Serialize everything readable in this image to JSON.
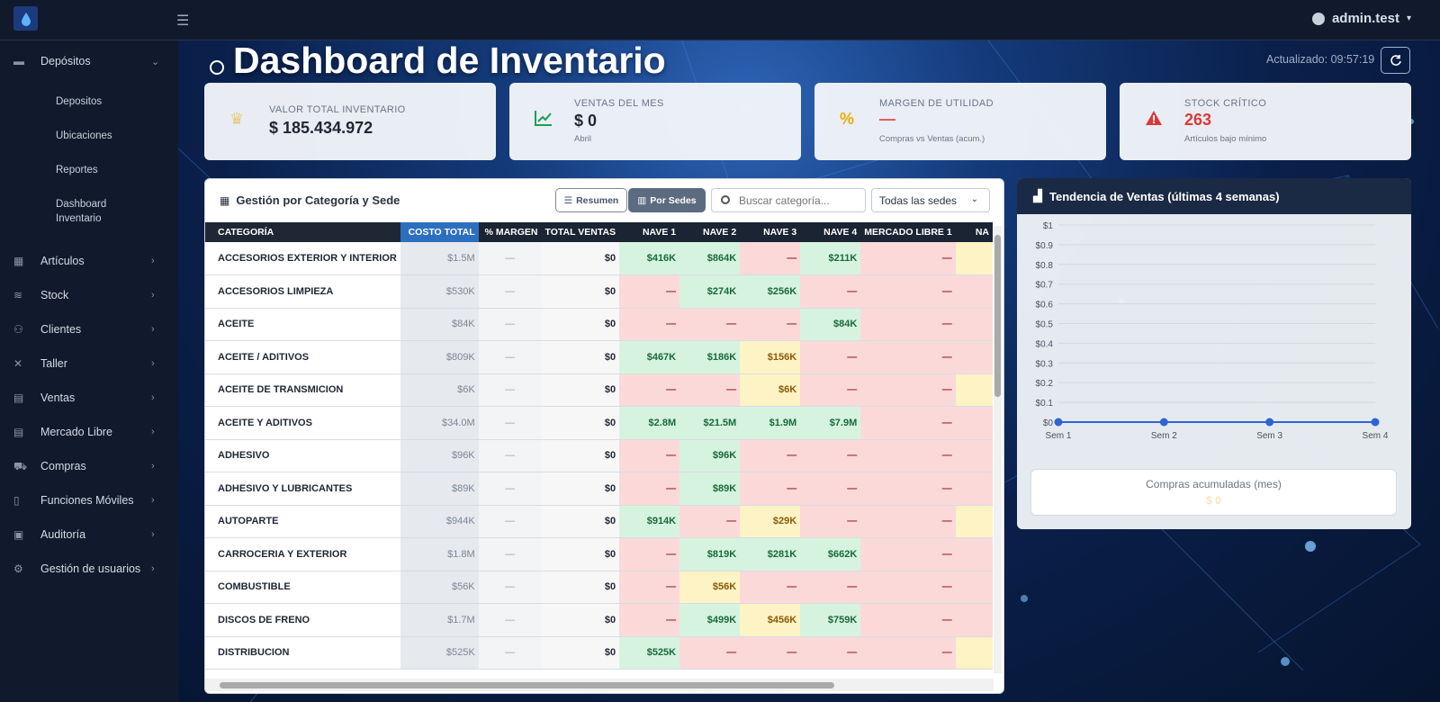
{
  "topbar": {
    "user": "admin.test",
    "icons": [
      "logo-icon",
      "menu-icon",
      "user-icon"
    ]
  },
  "sidebar": {
    "section": "Depósitos",
    "subitems": [
      "Depositos",
      "Ubicaciones",
      "Reportes",
      "Dashboard Inventario"
    ],
    "items": [
      "Artículos",
      "Stock",
      "Clientes",
      "Taller",
      "Ventas",
      "Mercado Libre",
      "Compras",
      "Funciones Móviles",
      "Auditoría",
      "Gestión de usuarios"
    ]
  },
  "header": {
    "title": "Dashboard de Inventario",
    "updated": "Actualizado: 09:57:19"
  },
  "kpis": [
    {
      "label": "VALOR TOTAL INVENTARIO",
      "value": "$ 185.434.972",
      "sub": "",
      "color": "#1f2733",
      "icon": "coins-icon",
      "icon_color": "#e7c97a"
    },
    {
      "label": "VENTAS DEL MES",
      "value": "$ 0",
      "sub": "Abril",
      "color": "#1f2733",
      "icon": "chart-line-icon",
      "icon_color": "#1f9d55"
    },
    {
      "label": "MARGEN DE UTILIDAD",
      "value": "—",
      "sub": "Compras vs Ventas (acum.)",
      "color": "#e05555",
      "icon": "percent-icon",
      "icon_color": "#f2a900"
    },
    {
      "label": "STOCK CRÍTICO",
      "value": "263",
      "sub": "Artículos bajo mínimo",
      "color": "#d93b3b",
      "icon": "warning-icon",
      "icon_color": "#d93b3b"
    }
  ],
  "table_panel": {
    "title": "Gestión por Categoría y Sede",
    "btn_resumen": "Resumen",
    "btn_sedes": "Por Sedes",
    "search_placeholder": "Buscar categoría...",
    "select_value": "Todas las sedes",
    "columns": [
      "CATEGORÍA",
      "COSTO TOTAL",
      "% MARGEN",
      "TOTAL VENTAS",
      "NAVE 1",
      "NAVE 2",
      "NAVE 3",
      "NAVE 4",
      "MERCADO LIBRE 1",
      "NA"
    ],
    "rows": [
      {
        "cat": "ACCESORIOS EXTERIOR Y INTERIOR",
        "cost": "$1.5M",
        "margin": "—",
        "sales": "$0",
        "n1": [
          "$416K",
          "g"
        ],
        "n2": [
          "$864K",
          "g"
        ],
        "n3": [
          "—",
          "r"
        ],
        "n4": [
          "$211K",
          "g"
        ],
        "ml": [
          "—",
          "r"
        ]
      },
      {
        "cat": "ACCESORIOS LIMPIEZA",
        "cost": "$530K",
        "margin": "—",
        "sales": "$0",
        "n1": [
          "—",
          "r"
        ],
        "n2": [
          "$274K",
          "g"
        ],
        "n3": [
          "$256K",
          "g"
        ],
        "n4": [
          "—",
          "r"
        ],
        "ml": [
          "—",
          "r"
        ]
      },
      {
        "cat": "ACEITE",
        "cost": "$84K",
        "margin": "—",
        "sales": "$0",
        "n1": [
          "—",
          "r"
        ],
        "n2": [
          "—",
          "r"
        ],
        "n3": [
          "—",
          "r"
        ],
        "n4": [
          "$84K",
          "g"
        ],
        "ml": [
          "—",
          "r"
        ]
      },
      {
        "cat": "ACEITE / ADITIVOS",
        "cost": "$809K",
        "margin": "—",
        "sales": "$0",
        "n1": [
          "$467K",
          "g"
        ],
        "n2": [
          "$186K",
          "g"
        ],
        "n3": [
          "$156K",
          "y"
        ],
        "n4": [
          "—",
          "r"
        ],
        "ml": [
          "—",
          "r"
        ]
      },
      {
        "cat": "ACEITE DE TRANSMICION",
        "cost": "$6K",
        "margin": "—",
        "sales": "$0",
        "n1": [
          "—",
          "r"
        ],
        "n2": [
          "—",
          "r"
        ],
        "n3": [
          "$6K",
          "y"
        ],
        "n4": [
          "—",
          "r"
        ],
        "ml": [
          "—",
          "r"
        ]
      },
      {
        "cat": "ACEITE Y ADITIVOS",
        "cost": "$34.0M",
        "margin": "—",
        "sales": "$0",
        "n1": [
          "$2.8M",
          "g"
        ],
        "n2": [
          "$21.5M",
          "g"
        ],
        "n3": [
          "$1.9M",
          "g"
        ],
        "n4": [
          "$7.9M",
          "g"
        ],
        "ml": [
          "—",
          "r"
        ]
      },
      {
        "cat": "ADHESIVO",
        "cost": "$96K",
        "margin": "—",
        "sales": "$0",
        "n1": [
          "—",
          "r"
        ],
        "n2": [
          "$96K",
          "g"
        ],
        "n3": [
          "—",
          "r"
        ],
        "n4": [
          "—",
          "r"
        ],
        "ml": [
          "—",
          "r"
        ]
      },
      {
        "cat": "ADHESIVO Y LUBRICANTES",
        "cost": "$89K",
        "margin": "—",
        "sales": "$0",
        "n1": [
          "—",
          "r"
        ],
        "n2": [
          "$89K",
          "g"
        ],
        "n3": [
          "—",
          "r"
        ],
        "n4": [
          "—",
          "r"
        ],
        "ml": [
          "—",
          "r"
        ]
      },
      {
        "cat": "AUTOPARTE",
        "cost": "$944K",
        "margin": "—",
        "sales": "$0",
        "n1": [
          "$914K",
          "g"
        ],
        "n2": [
          "—",
          "r"
        ],
        "n3": [
          "$29K",
          "y"
        ],
        "n4": [
          "—",
          "r"
        ],
        "ml": [
          "—",
          "r"
        ]
      },
      {
        "cat": "CARROCERIA Y EXTERIOR",
        "cost": "$1.8M",
        "margin": "—",
        "sales": "$0",
        "n1": [
          "—",
          "r"
        ],
        "n2": [
          "$819K",
          "g"
        ],
        "n3": [
          "$281K",
          "g"
        ],
        "n4": [
          "$662K",
          "g"
        ],
        "ml": [
          "—",
          "r"
        ]
      },
      {
        "cat": "COMBUSTIBLE",
        "cost": "$56K",
        "margin": "—",
        "sales": "$0",
        "n1": [
          "—",
          "r"
        ],
        "n2": [
          "$56K",
          "y"
        ],
        "n3": [
          "—",
          "r"
        ],
        "n4": [
          "—",
          "r"
        ],
        "ml": [
          "—",
          "r"
        ]
      },
      {
        "cat": "DISCOS DE FRENO",
        "cost": "$1.7M",
        "margin": "—",
        "sales": "$0",
        "n1": [
          "—",
          "r"
        ],
        "n2": [
          "$499K",
          "g"
        ],
        "n3": [
          "$456K",
          "y"
        ],
        "n4": [
          "$759K",
          "g"
        ],
        "ml": [
          "—",
          "r"
        ]
      },
      {
        "cat": "DISTRIBUCION",
        "cost": "$525K",
        "margin": "—",
        "sales": "$0",
        "n1": [
          "$525K",
          "g"
        ],
        "n2": [
          "—",
          "r"
        ],
        "n3": [
          "—",
          "r"
        ],
        "n4": [
          "—",
          "r"
        ],
        "ml": [
          "—",
          "r"
        ]
      }
    ]
  },
  "chart_panel": {
    "title": "Tendencia de Ventas (últimas 4 semanas)",
    "summary_label": "Compras acumuladas (mes)",
    "summary_value": "$ 0"
  },
  "chart_data": {
    "type": "line",
    "categories": [
      "Sem 1",
      "Sem 2",
      "Sem 3",
      "Sem 4"
    ],
    "series": [
      {
        "values": [
          0,
          0,
          0,
          0
        ],
        "color": "#2f64d6"
      }
    ],
    "yticks": [
      "$0",
      "$0.1",
      "$0.2",
      "$0.3",
      "$0.4",
      "$0.5",
      "$0.6",
      "$0.7",
      "$0.8",
      "$0.9",
      "$1"
    ],
    "ylim": [
      0,
      1
    ],
    "grid": true
  }
}
